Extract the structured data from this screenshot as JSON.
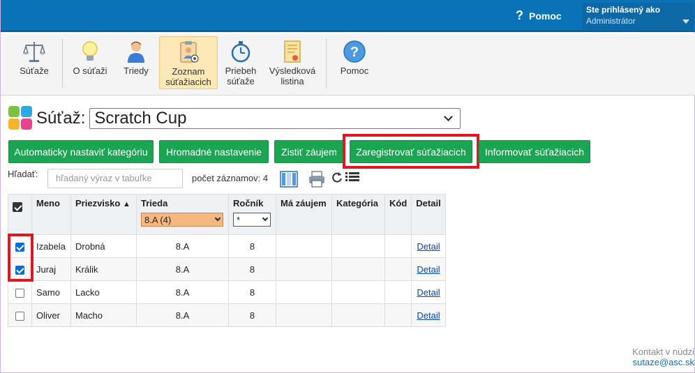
{
  "topbar": {
    "help_label": "Pomoc",
    "user_label": "Ste prihlásený ako",
    "user_value": "Administrátor"
  },
  "toolbar": {
    "items": [
      {
        "label": "Súťaže",
        "icon": "scales-icon"
      },
      {
        "label": "O súťaži",
        "icon": "lightbulb-icon"
      },
      {
        "label": "Triedy",
        "icon": "person-icon"
      },
      {
        "label": "Zoznam súťažiacich",
        "icon": "clipboard-icon"
      },
      {
        "label": "Priebeh súťaže",
        "icon": "stopwatch-icon"
      },
      {
        "label": "Výsledková listina",
        "icon": "certificate-icon"
      },
      {
        "label": "Pomoc",
        "icon": "help-icon"
      }
    ],
    "active_index": 3
  },
  "contest": {
    "label": "Súťaž:",
    "selected": "Scratch Cup"
  },
  "actions": {
    "auto_category": "Automaticky nastaviť kategóriu",
    "bulk_settings": "Hromadné nastavenie",
    "check_interest": "Zistiť záujem",
    "register": "Zaregistrovať súťažiacich",
    "inform": "Informovať súťažiacich"
  },
  "search": {
    "label": "Hľadať:",
    "placeholder": "hľadaný výraz v tabuľke",
    "count_text": "počet záznamov: 4"
  },
  "table": {
    "headers": {
      "meno": "Meno",
      "priezvisko": "Priezvisko",
      "trieda": "Trieda",
      "rocnik": "Ročník",
      "zaujem": "Má záujem",
      "kategoria": "Kategória",
      "kod": "Kód",
      "detail": "Detail"
    },
    "filters": {
      "trieda": "8.A (4)",
      "rocnik": "*"
    },
    "rows": [
      {
        "checked": true,
        "meno": "Izabela",
        "priezvisko": "Drobná",
        "trieda": "8.A",
        "rocnik": "8",
        "zaujem": "",
        "kategoria": "",
        "kod": "",
        "detail": "Detail"
      },
      {
        "checked": true,
        "meno": "Juraj",
        "priezvisko": "Králik",
        "trieda": "8.A",
        "rocnik": "8",
        "zaujem": "",
        "kategoria": "",
        "kod": "",
        "detail": "Detail"
      },
      {
        "checked": false,
        "meno": "Samo",
        "priezvisko": "Lacko",
        "trieda": "8.A",
        "rocnik": "8",
        "zaujem": "",
        "kategoria": "",
        "kod": "",
        "detail": "Detail"
      },
      {
        "checked": false,
        "meno": "Oliver",
        "priezvisko": "Macho",
        "trieda": "8.A",
        "rocnik": "8",
        "zaujem": "",
        "kategoria": "",
        "kod": "",
        "detail": "Detail"
      }
    ]
  },
  "contact": {
    "label": "Kontakt v núdzi",
    "email": "sutaze@asc.sk"
  },
  "colors": {
    "topbar": "#0a73b8",
    "action_button": "#1aa552",
    "highlight_frame": "#e3161f",
    "active_tab": "#fde9b8"
  }
}
